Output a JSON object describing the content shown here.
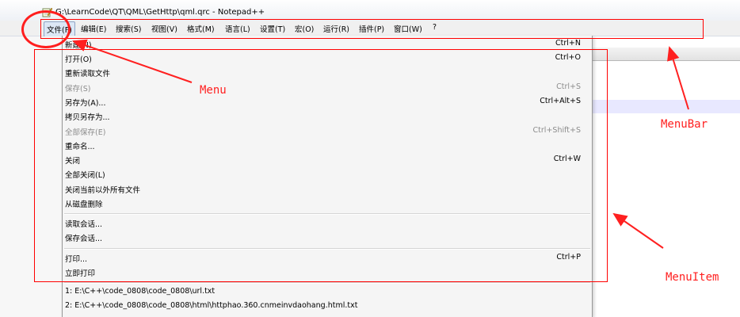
{
  "window": {
    "title": "G:\\LearnCode\\QT\\QML\\GetHttp\\qml.qrc - Notepad++",
    "app_icon": "notepad-icon"
  },
  "menubar": {
    "items": [
      {
        "label": "文件(F)",
        "active": true
      },
      {
        "label": "编辑(E)"
      },
      {
        "label": "搜索(S)"
      },
      {
        "label": "视图(V)"
      },
      {
        "label": "格式(M)"
      },
      {
        "label": "语言(L)"
      },
      {
        "label": "设置(T)"
      },
      {
        "label": "宏(O)"
      },
      {
        "label": "运行(R)"
      },
      {
        "label": "插件(P)"
      },
      {
        "label": "窗口(W)"
      },
      {
        "label": "?"
      }
    ]
  },
  "file_menu": {
    "items": [
      {
        "label": "新建(N)",
        "shortcut": "Ctrl+N"
      },
      {
        "label": "打开(O)",
        "shortcut": "Ctrl+O"
      },
      {
        "label": "重新读取文件",
        "shortcut": ""
      },
      {
        "label": "保存(S)",
        "shortcut": "Ctrl+S",
        "disabled": true
      },
      {
        "label": "另存为(A)...",
        "shortcut": "Ctrl+Alt+S"
      },
      {
        "label": "拷贝另存为...",
        "shortcut": ""
      },
      {
        "label": "全部保存(E)",
        "shortcut": "Ctrl+Shift+S",
        "disabled": true
      },
      {
        "label": "重命名...",
        "shortcut": ""
      },
      {
        "label": "关闭",
        "shortcut": "Ctrl+W"
      },
      {
        "label": "全部关闭(L)",
        "shortcut": ""
      },
      {
        "label": "关闭当前以外所有文件",
        "shortcut": ""
      },
      {
        "label": "从磁盘删除",
        "shortcut": ""
      },
      {
        "label": "读取会话...",
        "shortcut": ""
      },
      {
        "label": "保存会话...",
        "shortcut": ""
      },
      {
        "label": "打印...",
        "shortcut": "Ctrl+P"
      },
      {
        "label": "立即打印",
        "shortcut": ""
      }
    ],
    "recent_files": [
      "1: E:\\C++\\code_0808\\code_0808\\url.txt",
      "2: E:\\C++\\code_0808\\code_0808\\html\\httphao.360.cnmeinvdaohang.html.txt"
    ]
  },
  "annotations": {
    "menu": "Menu",
    "menubar": "MenuBar",
    "menuitem": "MenuItem",
    "color": "#ff2020"
  }
}
